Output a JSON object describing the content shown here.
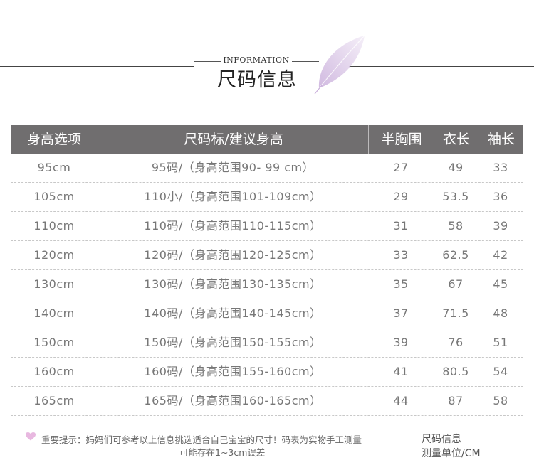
{
  "header": {
    "title_en": "INFORMATION",
    "title_cn": "尺码信息"
  },
  "table": {
    "headers": [
      "身高选项",
      "尺码标/建议身高",
      "半胸围",
      "衣长",
      "袖长"
    ],
    "rows": [
      [
        "95cm",
        "95码/（身高范围90- 99 cm）",
        "27",
        "49",
        "33"
      ],
      [
        "105cm",
        "110小/（身高范围101-109cm）",
        "29",
        "53.5",
        "36"
      ],
      [
        "110cm",
        "110码/（身高范围110-115cm）",
        "31",
        "58",
        "39"
      ],
      [
        "120cm",
        "120码/（身高范围120-125cm）",
        "33",
        "62.5",
        "42"
      ],
      [
        "130cm",
        "130码/（身高范围130-135cm）",
        "35",
        "67",
        "45"
      ],
      [
        "140cm",
        "140码/（身高范围140-145cm）",
        "37",
        "71.5",
        "48"
      ],
      [
        "150cm",
        "150码/（身高范围150-155cm）",
        "39",
        "76",
        "51"
      ],
      [
        "160cm",
        "160码/（身高范围155-160cm）",
        "41",
        "80.5",
        "54"
      ],
      [
        "165cm",
        "165码/（身高范围160-165cm）",
        "44",
        "87",
        "58"
      ]
    ]
  },
  "footer": {
    "note_line1": "重要提示：妈妈们可参考以上信息挑选适合自己宝宝的尺寸！码表为实物手工测量",
    "note_line2": "可能存在1~3cm误差",
    "right_line1": "尺码信息",
    "right_line2": "测量单位/CM"
  },
  "colors": {
    "header_bg": "#706e6f",
    "heart": "#e8b8e0",
    "leaf": "#d9c6e6"
  }
}
